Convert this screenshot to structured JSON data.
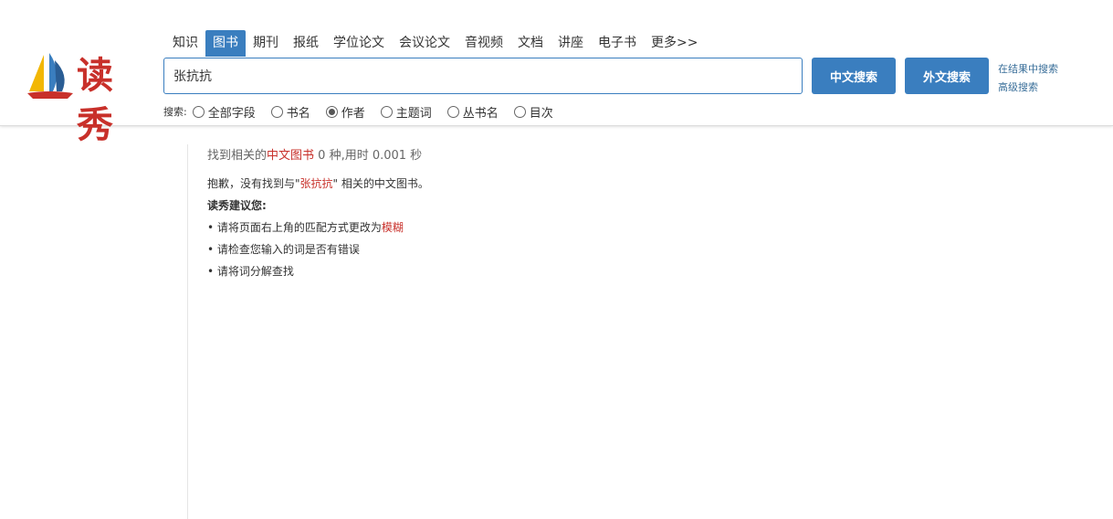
{
  "brand": {
    "logo_text": "读秀",
    "colors": {
      "sail_blue": "#3a7ebf",
      "sail_yellow": "#f2b705",
      "sail_red": "#c8302a",
      "accent": "#3a7ebf"
    }
  },
  "nav": {
    "tabs": [
      {
        "label": "知识",
        "active": false
      },
      {
        "label": "图书",
        "active": true
      },
      {
        "label": "期刊",
        "active": false
      },
      {
        "label": "报纸",
        "active": false
      },
      {
        "label": "学位论文",
        "active": false
      },
      {
        "label": "会议论文",
        "active": false
      },
      {
        "label": "音视频",
        "active": false
      },
      {
        "label": "文档",
        "active": false
      },
      {
        "label": "讲座",
        "active": false
      },
      {
        "label": "电子书",
        "active": false
      },
      {
        "label": "更多>>",
        "active": false
      }
    ]
  },
  "search": {
    "value": "张抗抗",
    "cn_button": "中文搜索",
    "foreign_button": "外文搜索",
    "in_results_link": "在结果中搜索",
    "advanced_link": "高级搜索",
    "fields_label": "搜索:",
    "fields": [
      {
        "label": "全部字段",
        "checked": false
      },
      {
        "label": "书名",
        "checked": false
      },
      {
        "label": "作者",
        "checked": true
      },
      {
        "label": "主题词",
        "checked": false
      },
      {
        "label": "丛书名",
        "checked": false
      },
      {
        "label": "目次",
        "checked": false
      }
    ]
  },
  "results": {
    "summary_prefix": "找到相关的",
    "summary_category": "中文图书",
    "summary_suffix": " 0 种,用时 0.001 秒",
    "sorry_prefix": "抱歉，没有找到与\"",
    "sorry_query": "张抗抗",
    "sorry_suffix": "\" 相关的中文图书。",
    "suggest_title": "读秀建议您:",
    "suggestion_1_prefix": "请将页面右上角的匹配方式更改为",
    "suggestion_1_link": "模糊",
    "suggestion_2": "请检查您输入的词是否有错误",
    "suggestion_3": "请将词分解查找"
  }
}
